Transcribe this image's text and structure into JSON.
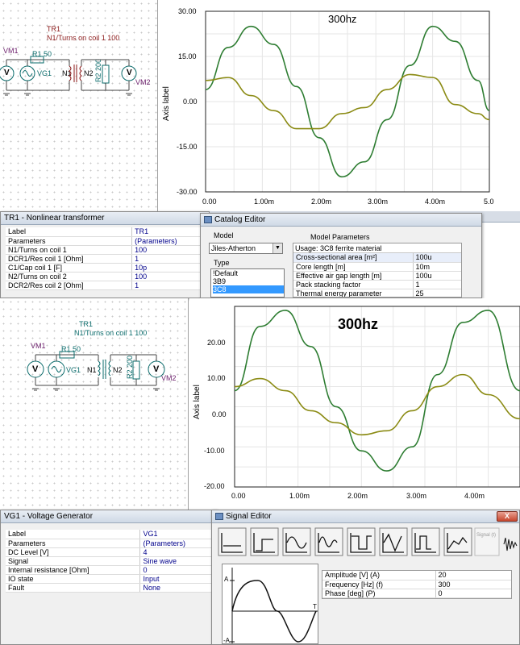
{
  "top": {
    "schematic": {
      "tr_label": "TR1",
      "tr_turns": "N1/Turns on coil 1 100",
      "vm1": "VM1",
      "r1": "R1 50",
      "vg1": "VG1",
      "n1": "N1",
      "n2": "N2",
      "r2": "R2 200",
      "vm2": "VM2",
      "v_glyph": "V"
    },
    "chart": {
      "title": "300hz",
      "ylabel": "Axis label",
      "yticks": [
        "30.00",
        "15.00",
        "0.00",
        "-15.00",
        "-30.00"
      ],
      "xticks": [
        "0.00",
        "1.00m",
        "2.00m",
        "3.00m",
        "4.00m",
        "5.0"
      ]
    }
  },
  "tr1_window": {
    "title": "TR1 - Nonlinear transformer",
    "rows": [
      [
        "Label",
        "TR1"
      ],
      [
        "Parameters",
        "(Parameters)"
      ],
      [
        "N1/Turns on coil 1",
        "100"
      ],
      [
        "DCR1/Res coil 1 [Ohm]",
        "1"
      ],
      [
        "C1/Cap coil 1   [F]",
        "10p"
      ],
      [
        "N2/Turns on coil 2",
        "100"
      ],
      [
        "DCR2/Res coil 2 [Ohm]",
        "1"
      ]
    ]
  },
  "catalog": {
    "title": "Catalog Editor",
    "model_label": "Model",
    "model_value": "Jiles-Atherton",
    "type_label": "Type",
    "types": [
      "!Default",
      "3B9",
      "3C8"
    ],
    "params_header": "Model Parameters",
    "usage": "Usage: 3C8 ferrite material",
    "params": [
      [
        "Cross-sectional area [m²]",
        "100u"
      ],
      [
        "Core length [m]",
        "10m"
      ],
      [
        "Effective air gap length [m]",
        "100u"
      ],
      [
        "Pack stacking factor",
        "1"
      ],
      [
        "Thermal energy parameter",
        "25"
      ]
    ]
  },
  "bottom": {
    "schematic": {
      "tr_label": "TR1",
      "tr_turns": "N1/Turns on coil 1 100",
      "vm1": "VM1",
      "r1": "R1 50",
      "vg1": "VG1",
      "n1": "N1",
      "n2": "N2",
      "r2": "R2 200",
      "vm2": "VM2",
      "v_glyph": "V"
    },
    "chart": {
      "title": "300hz",
      "ylabel": "Axis label",
      "yticks": [
        "20.00",
        "10.00",
        "0.00",
        "-10.00",
        "-20.00"
      ],
      "xticks": [
        "0.00",
        "1.00m",
        "2.00m",
        "3.00m",
        "4.00m"
      ]
    }
  },
  "vg1_window": {
    "title": "VG1 - Voltage Generator",
    "rows": [
      [
        "Label",
        "VG1"
      ],
      [
        "Parameters",
        "(Parameters)"
      ],
      [
        "DC Level [V]",
        "4"
      ],
      [
        "Signal",
        "Sine wave"
      ],
      [
        "Internal resistance [Ohm]",
        "0"
      ],
      [
        "IO state",
        "Input"
      ],
      [
        "Fault",
        "None"
      ]
    ]
  },
  "signal_editor": {
    "title": "Signal Editor",
    "close": "X",
    "disabled_button": "Signal (t)",
    "preview": {
      "amp_top": "A",
      "amp_bottom": "-A",
      "t_label": "T"
    },
    "params": [
      [
        "Amplitude [V] (A)",
        "20"
      ],
      [
        "Frequency [Hz] (f)",
        "300"
      ],
      [
        "Phase [deg] (P)",
        "0"
      ]
    ]
  },
  "chart_data": [
    {
      "type": "line",
      "title": "300hz",
      "xlabel": "",
      "ylabel": "Axis label",
      "xlim": [
        0,
        0.005
      ],
      "ylim": [
        -30,
        30
      ],
      "series": [
        {
          "color": "#2e7d32",
          "x": [
            0,
            0.0004,
            0.0008,
            0.0012,
            0.0016,
            0.002,
            0.0024,
            0.0028,
            0.0032,
            0.0036,
            0.004,
            0.0044,
            0.0048,
            0.005
          ],
          "values": [
            4,
            18,
            25,
            19,
            5,
            -12,
            -25,
            -20,
            -6,
            12,
            25,
            20,
            7,
            -3
          ]
        },
        {
          "color": "#8b8b14",
          "x": [
            0,
            0.0004,
            0.0008,
            0.0012,
            0.0016,
            0.002,
            0.0024,
            0.0028,
            0.0032,
            0.0036,
            0.004,
            0.0044,
            0.0048,
            0.005
          ],
          "values": [
            7,
            8,
            2,
            -3,
            -9,
            -9,
            -4,
            -2,
            4,
            9,
            8,
            -1,
            -4,
            -6
          ]
        }
      ]
    },
    {
      "type": "line",
      "title": "300hz",
      "xlabel": "",
      "ylabel": "Axis label",
      "xlim": [
        0,
        0.0045
      ],
      "ylim": [
        -20,
        25
      ],
      "series": [
        {
          "color": "#2e7d32",
          "x": [
            0,
            0.0004,
            0.0008,
            0.0012,
            0.0016,
            0.002,
            0.0024,
            0.0028,
            0.0032,
            0.0036,
            0.004,
            0.0045
          ],
          "values": [
            4,
            20,
            24,
            15,
            0,
            -11,
            -16,
            -10,
            8,
            21,
            24,
            4
          ]
        },
        {
          "color": "#8b8b14",
          "x": [
            0,
            0.0004,
            0.0008,
            0.0012,
            0.0016,
            0.002,
            0.0024,
            0.0028,
            0.0032,
            0.0036,
            0.004,
            0.0045
          ],
          "values": [
            5,
            7,
            4,
            -1,
            -4,
            -7,
            -6,
            -1,
            5,
            8,
            3,
            -3
          ]
        }
      ]
    }
  ]
}
